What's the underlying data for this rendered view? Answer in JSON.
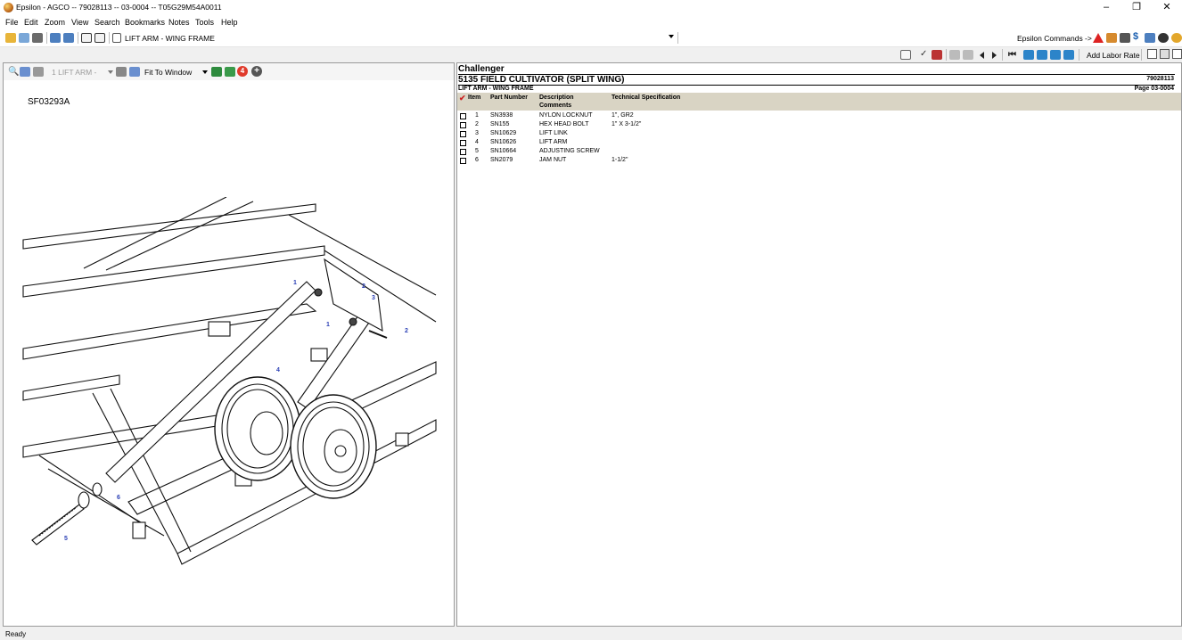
{
  "window": {
    "title": "Epsilon - AGCO -- 79028113 -- 03-0004 -- T05G29M54A0011",
    "minimize_glyph": "–",
    "restore_glyph": "❐",
    "close_glyph": "✕"
  },
  "menu": [
    "File",
    "Edit",
    "Zoom",
    "View",
    "Search",
    "Bookmarks",
    "Notes",
    "Tools",
    "Help"
  ],
  "toolbar": {
    "path_label": "LIFT ARM - WING FRAME",
    "commands_label": "Epsilon Commands ->",
    "add_labor_rate": "Add Labor Rate"
  },
  "left_toolbar": {
    "callout_select": "1 LIFT ARM -",
    "fit_label": "Fit To Window",
    "badge_count": "4"
  },
  "drawing": {
    "figure_id": "SF03293A",
    "callouts": [
      "1",
      "2",
      "3",
      "1",
      "2",
      "4",
      "6",
      "5"
    ]
  },
  "parts_page": {
    "brand": "Challenger",
    "model": "5135 FIELD CULTIVATOR (SPLIT WING)",
    "doc_number": "79028113",
    "section": "LIFT ARM - WING FRAME",
    "page_label": "Page 03-0004",
    "columns": {
      "item": "Item",
      "part_number": "Part Number",
      "description": "Description",
      "comments": "Comments",
      "tech_spec": "Technical Specification"
    },
    "rows": [
      {
        "item": "1",
        "part": "SN3938",
        "desc": "NYLON LOCKNUT",
        "spec": "1\", GR2"
      },
      {
        "item": "2",
        "part": "SN155",
        "desc": "HEX HEAD BOLT",
        "spec": "1\" X 3-1/2\""
      },
      {
        "item": "3",
        "part": "SN10629",
        "desc": "LIFT LINK",
        "spec": ""
      },
      {
        "item": "4",
        "part": "SN10626",
        "desc": "LIFT ARM",
        "spec": ""
      },
      {
        "item": "5",
        "part": "SN10664",
        "desc": "ADJUSTING SCREW",
        "spec": ""
      },
      {
        "item": "6",
        "part": "SN2079",
        "desc": "JAM NUT",
        "spec": "1-1/2\""
      }
    ]
  },
  "status": "Ready",
  "colors": {
    "badge_red": "#e03a2b",
    "header_band": "#d9d4c4",
    "callout_blue": "#2a3fb5",
    "check_red": "#cc2222"
  }
}
